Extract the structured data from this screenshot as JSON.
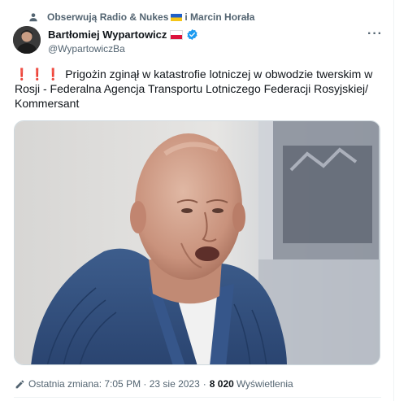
{
  "social_context": {
    "text_before_flag": "Obserwują Radio & Nukes",
    "text_after_flag": "i Marcin Horała",
    "icon": "person-icon"
  },
  "author": {
    "name": "Bartłomiej Wypartowicz",
    "handle": "@WypartowiczBa",
    "verified": true,
    "verified_color": "#1d9bf0"
  },
  "more_label": "···",
  "tweet": {
    "marks": "❗❗❗",
    "text": "Prigożin zginął w katastrofie lotniczej w obwodzie twerskim w Rosji  - Federalna Agencja Transportu Lotniczego Federacji Rosyjskiej/ Kommersant"
  },
  "media": {
    "alt": "photo-of-yevgeny-prigozhin"
  },
  "meta": {
    "edited_label": "Ostatnia zmiana: 7:05 PM · 23 sie 2023",
    "separator": "·",
    "views_count": "8 020",
    "views_label": "Wyświetlenia"
  },
  "colors": {
    "text_primary": "#0f1419",
    "text_secondary": "#536471",
    "accent": "#1d9bf0",
    "alert_red": "#e0242b"
  }
}
